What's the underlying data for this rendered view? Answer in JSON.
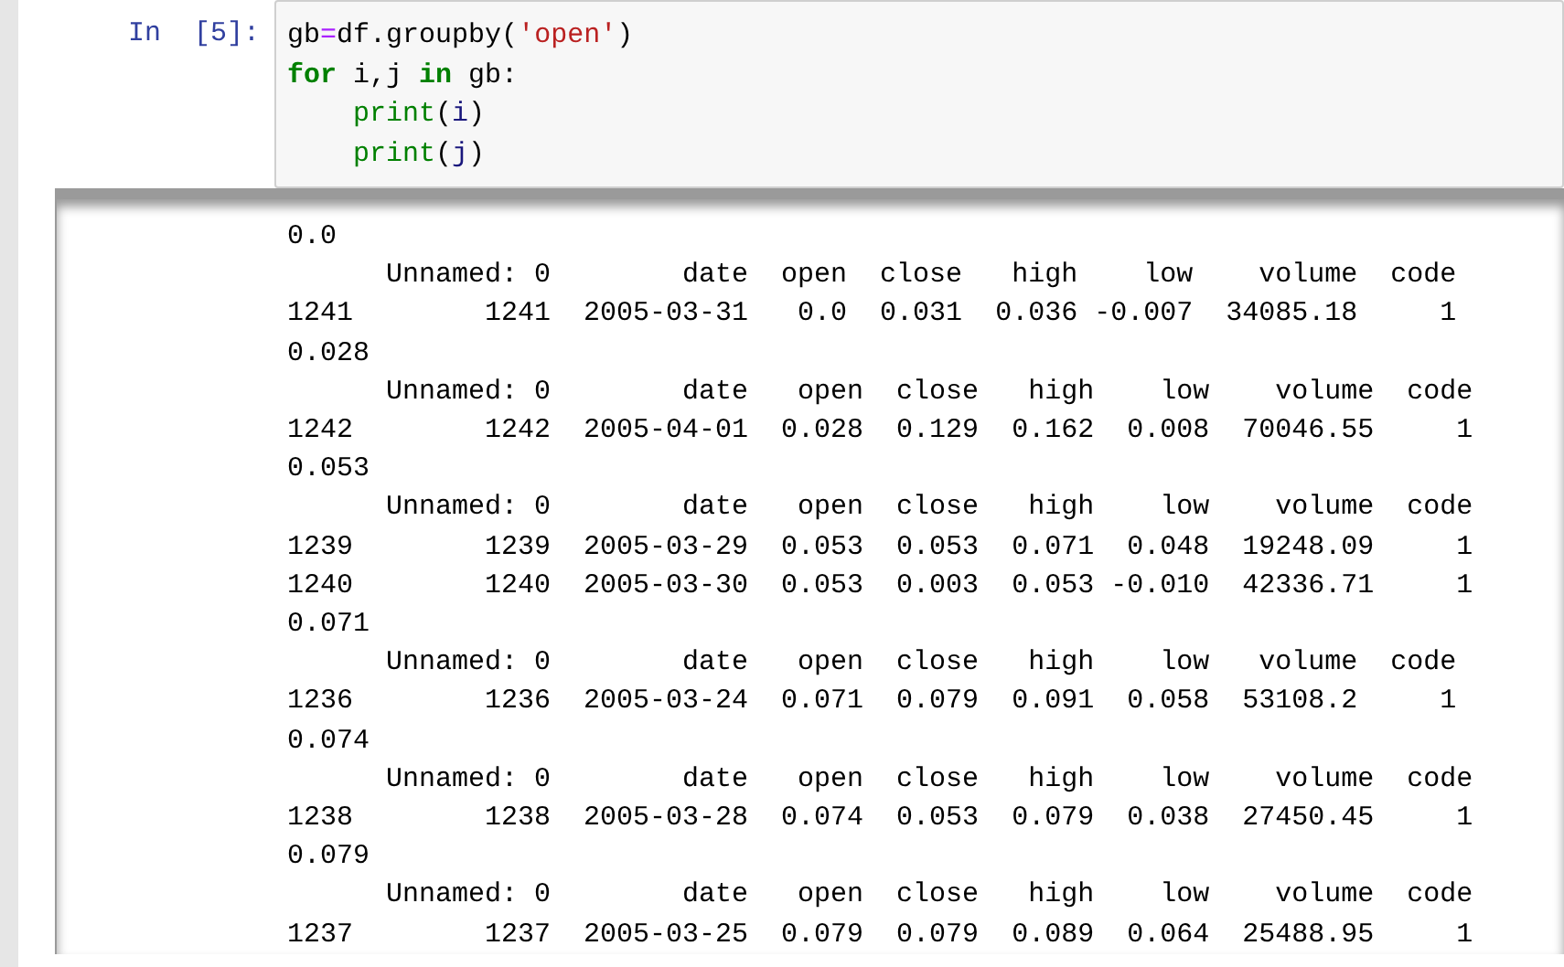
{
  "cell": {
    "prompt": "In  [5]:",
    "code": [
      [
        {
          "kind": "name",
          "text": "gb"
        },
        {
          "kind": "operator",
          "text": "="
        },
        {
          "kind": "name",
          "text": "df.groupby("
        },
        {
          "kind": "string",
          "text": "'open'"
        },
        {
          "kind": "name",
          "text": ")"
        }
      ],
      [
        {
          "kind": "keyword",
          "text": "for"
        },
        {
          "kind": "name",
          "text": " i,j "
        },
        {
          "kind": "keyword",
          "text": "in"
        },
        {
          "kind": "name",
          "text": " gb:"
        }
      ],
      [
        {
          "kind": "builtin",
          "text": "    print"
        },
        {
          "kind": "name",
          "text": "("
        },
        {
          "kind": "variable",
          "text": "i"
        },
        {
          "kind": "name",
          "text": ")"
        }
      ],
      [
        {
          "kind": "builtin",
          "text": "    print"
        },
        {
          "kind": "name",
          "text": "("
        },
        {
          "kind": "variable",
          "text": "j"
        },
        {
          "kind": "name",
          "text": ")"
        }
      ]
    ]
  },
  "output": {
    "lines": [
      "0.0",
      "      Unnamed: 0        date  open  close   high    low    volume  code",
      "1241        1241  2005-03-31   0.0  0.031  0.036 -0.007  34085.18     1",
      "0.028",
      "      Unnamed: 0        date   open  close   high    low    volume  code",
      "1242        1242  2005-04-01  0.028  0.129  0.162  0.008  70046.55     1",
      "0.053",
      "      Unnamed: 0        date   open  close   high    low    volume  code",
      "1239        1239  2005-03-29  0.053  0.053  0.071  0.048  19248.09     1",
      "1240        1240  2005-03-30  0.053  0.003  0.053 -0.010  42336.71     1",
      "0.071",
      "      Unnamed: 0        date   open  close   high    low   volume  code",
      "1236        1236  2005-03-24  0.071  0.079  0.091  0.058  53108.2     1",
      "0.074",
      "      Unnamed: 0        date   open  close   high    low    volume  code",
      "1238        1238  2005-03-28  0.074  0.053  0.079  0.038  27450.45     1",
      "0.079",
      "      Unnamed: 0        date   open  close   high    low    volume  code",
      "1237        1237  2005-03-25  0.079  0.079  0.089  0.064  25488.95     1"
    ]
  }
}
